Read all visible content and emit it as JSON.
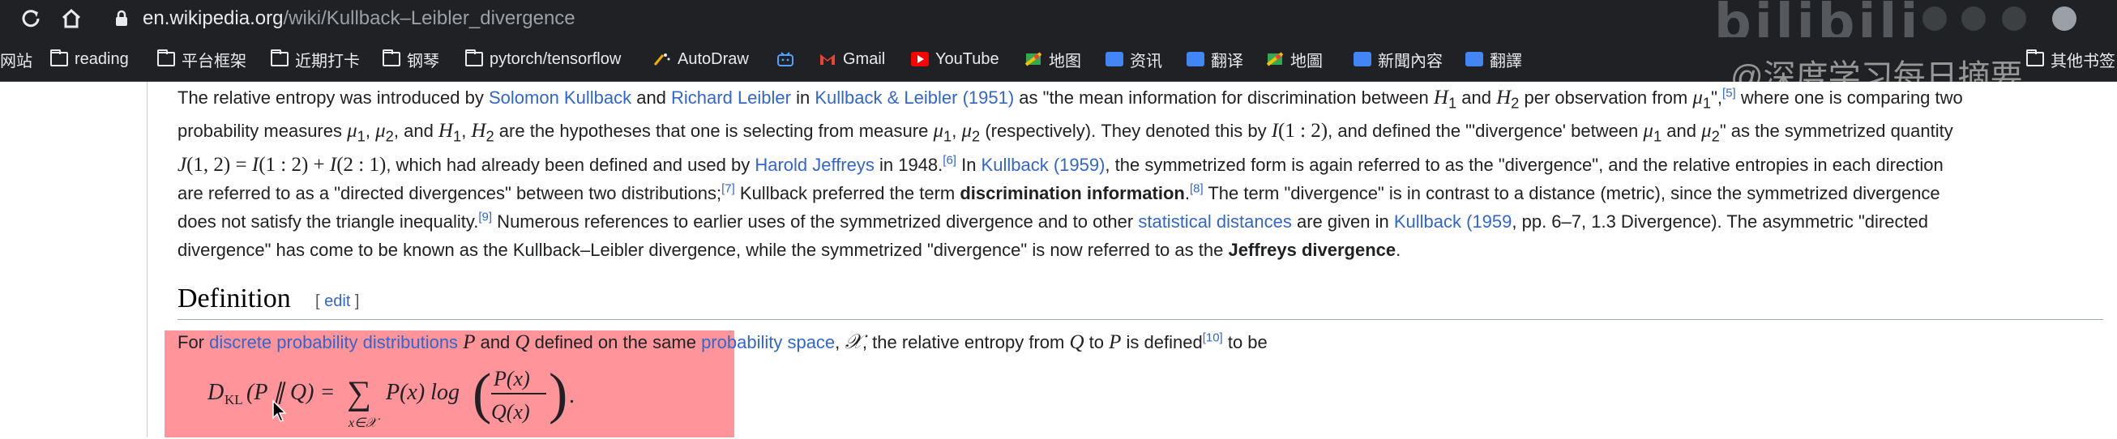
{
  "browser": {
    "url_host": "en.wikipedia.org",
    "url_path": "/wiki/Kullback–Leibler_divergence",
    "watermark_logo": "bilibili",
    "watermark_text": "@深度学习每日摘要"
  },
  "bookmarks": [
    {
      "label": "网站",
      "icon": "none"
    },
    {
      "label": "reading",
      "icon": "folder-icon"
    },
    {
      "label": "平台框架",
      "icon": "folder-icon"
    },
    {
      "label": "近期打卡",
      "icon": "folder-icon"
    },
    {
      "label": "钢琴",
      "icon": "folder-icon"
    },
    {
      "label": "pytorch/tensorflow",
      "icon": "folder-icon"
    },
    {
      "label": "AutoDraw",
      "icon": "autodraw-icon"
    },
    {
      "label": "",
      "icon": "bilibili-icon"
    },
    {
      "label": "Gmail",
      "icon": "gmail-icon"
    },
    {
      "label": "YouTube",
      "icon": "youtube-icon"
    },
    {
      "label": "地图",
      "icon": "maps-icon"
    },
    {
      "label": "资讯",
      "icon": "news-icon"
    },
    {
      "label": "翻译",
      "icon": "translate-icon"
    },
    {
      "label": "地圖",
      "icon": "maps-icon"
    },
    {
      "label": "新聞內容",
      "icon": "news-icon"
    },
    {
      "label": "翻譯",
      "icon": "translate-icon"
    },
    {
      "label": "其他书签",
      "icon": "folder-icon"
    }
  ],
  "article": {
    "p1": [
      "The relative entropy was introduced by ",
      "Solomon Kullback",
      " and ",
      "Richard Leibler",
      " in ",
      "Kullback & Leibler (1951)",
      " as \"the mean information for discrimination between ",
      "H",
      "1",
      " and ",
      "H",
      "2",
      " per observation from ",
      "μ",
      "1",
      "\",",
      "[5]",
      " where one is comparing two"
    ],
    "p2": [
      "probability measures ",
      "μ",
      "1",
      ", ",
      "μ",
      "2",
      ", and ",
      "H",
      "1",
      ", ",
      "H",
      "2",
      " are the hypotheses that one is selecting from measure ",
      "μ",
      "1",
      ", ",
      "μ",
      "2",
      " (respectively). They denoted this by ",
      "I",
      "(1 : 2)",
      ", and defined the \"'divergence' between ",
      "μ",
      "1",
      " and ",
      "μ",
      "2",
      "\" as the symmetrized quantity"
    ],
    "p3": [
      "J",
      "(1, 2) = ",
      "I",
      "(1 : 2) + ",
      "I",
      "(2 : 1)",
      ", which had already been defined and used by ",
      "Harold Jeffreys",
      " in 1948.",
      "[6]",
      " In ",
      "Kullback (1959)",
      ", the symmetrized form is again referred to as the \"divergence\", and the relative entropies in each direction"
    ],
    "p4": [
      "are referred to as a \"directed divergences\" between two distributions;",
      "[7]",
      " Kullback preferred the term ",
      "discrimination information",
      ".",
      "[8]",
      " The term \"divergence\" is in contrast to a distance (metric), since the symmetrized divergence"
    ],
    "p5": [
      "does not satisfy the triangle inequality.",
      "[9]",
      " Numerous references to earlier uses of the symmetrized divergence and to other ",
      "statistical distances",
      " are given in ",
      "Kullback (1959",
      ", pp. 6–7, 1.3 Divergence). The asymmetric \"directed"
    ],
    "p6": [
      "divergence\" has come to be known as the Kullback–Leibler divergence, while the symmetrized \"divergence\" is now referred to as the ",
      "Jeffreys divergence",
      "."
    ],
    "heading": "Definition",
    "edit_open": "[ ",
    "edit": "edit",
    "edit_close": " ]",
    "def": [
      "For ",
      "discrete probability distributions",
      " ",
      "P",
      " and ",
      "Q",
      " defined on the same ",
      "probability space",
      ", ",
      "𝒳",
      ", the relative entropy from ",
      "Q",
      " to ",
      "P",
      " is defined",
      "[10]",
      " to be"
    ],
    "formula": {
      "D": "D",
      "KL": "KL",
      "lhs_args": "(P ∥ Q) =",
      "sum": "∑",
      "sub": "x∈𝒳",
      "term": "P(x) log",
      "num": "P(x)",
      "den": "Q(x)",
      "end": "."
    }
  },
  "colors": {
    "link": "#3366cc",
    "highlight": "#ff8f95",
    "chrome": "#202124"
  }
}
